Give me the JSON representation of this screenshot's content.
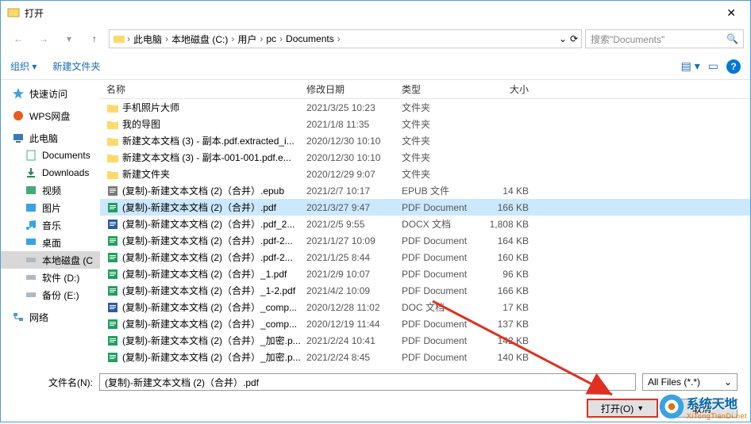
{
  "window": {
    "title": "打开",
    "close": "✕"
  },
  "breadcrumb": [
    "此电脑",
    "本地磁盘 (C:)",
    "用户",
    "pc",
    "Documents"
  ],
  "search": {
    "placeholder": "搜索\"Documents\""
  },
  "toolbar": {
    "organize": "组织 ▾",
    "newfolder": "新建文件夹"
  },
  "sidebar": {
    "quick": "快速访问",
    "wps": "WPS网盘",
    "thispc": "此电脑",
    "documents": "Documents",
    "downloads": "Downloads",
    "videos": "视频",
    "pictures": "图片",
    "music": "音乐",
    "desktop": "桌面",
    "cdrive": "本地磁盘 (C",
    "ddrive": "软件 (D:)",
    "edrive": "备份 (E:)",
    "network": "网络"
  },
  "columns": {
    "name": "名称",
    "date": "修改日期",
    "type": "类型",
    "size": "大小"
  },
  "files": [
    {
      "icon": "folder",
      "name": "手机照片大师",
      "date": "2021/3/25 10:23",
      "type": "文件夹",
      "size": ""
    },
    {
      "icon": "folder",
      "name": "我的导图",
      "date": "2021/1/8 11:35",
      "type": "文件夹",
      "size": ""
    },
    {
      "icon": "folder",
      "name": "新建文本文档 (3) - 副本.pdf.extracted_i...",
      "date": "2020/12/30 10:10",
      "type": "文件夹",
      "size": ""
    },
    {
      "icon": "folder",
      "name": "新建文本文档 (3) - 副本-001-001.pdf.e...",
      "date": "2020/12/30 10:10",
      "type": "文件夹",
      "size": ""
    },
    {
      "icon": "folder",
      "name": "新建文件夹",
      "date": "2020/12/29 9:07",
      "type": "文件夹",
      "size": ""
    },
    {
      "icon": "epub",
      "name": "(复制)-新建文本文档 (2)（合并）.epub",
      "date": "2021/2/7 10:17",
      "type": "EPUB 文件",
      "size": "14 KB"
    },
    {
      "icon": "pdf",
      "name": "(复制)-新建文本文档 (2)（合并）.pdf",
      "date": "2021/3/27 9:47",
      "type": "PDF Document",
      "size": "166 KB",
      "sel": true
    },
    {
      "icon": "docx",
      "name": "(复制)-新建文本文档 (2)（合并）.pdf_2...",
      "date": "2021/2/5 9:55",
      "type": "DOCX 文档",
      "size": "1,808 KB"
    },
    {
      "icon": "pdf",
      "name": "(复制)-新建文本文档 (2)（合并）.pdf-2...",
      "date": "2021/1/27 10:09",
      "type": "PDF Document",
      "size": "164 KB"
    },
    {
      "icon": "pdf",
      "name": "(复制)-新建文本文档 (2)（合并）.pdf-2...",
      "date": "2021/1/25 8:44",
      "type": "PDF Document",
      "size": "160 KB"
    },
    {
      "icon": "pdf",
      "name": "(复制)-新建文本文档 (2)（合并）_1.pdf",
      "date": "2021/2/9 10:07",
      "type": "PDF Document",
      "size": "96 KB"
    },
    {
      "icon": "pdf",
      "name": "(复制)-新建文本文档 (2)（合并）_1-2.pdf",
      "date": "2021/4/2 10:09",
      "type": "PDF Document",
      "size": "166 KB"
    },
    {
      "icon": "doc",
      "name": "(复制)-新建文本文档 (2)（合并）_comp...",
      "date": "2020/12/28 11:02",
      "type": "DOC 文档",
      "size": "17 KB"
    },
    {
      "icon": "pdf",
      "name": "(复制)-新建文本文档 (2)（合并）_comp...",
      "date": "2020/12/19 11:44",
      "type": "PDF Document",
      "size": "137 KB"
    },
    {
      "icon": "pdf",
      "name": "(复制)-新建文本文档 (2)（合并）_加密.p...",
      "date": "2021/2/24 10:41",
      "type": "PDF Document",
      "size": "142 KB"
    },
    {
      "icon": "pdf",
      "name": "(复制)-新建文本文档 (2)（合并）_加密.p...",
      "date": "2021/2/24 8:45",
      "type": "PDF Document",
      "size": "140 KB"
    }
  ],
  "filename": {
    "label": "文件名(N):",
    "value": "(复制)-新建文本文档 (2)（合并）.pdf"
  },
  "filter": "All Files (*.*)",
  "buttons": {
    "open": "打开(O)",
    "cancel": "取消"
  },
  "watermark": {
    "text": "系统天地",
    "sub": "XiTongTianDi.net"
  }
}
